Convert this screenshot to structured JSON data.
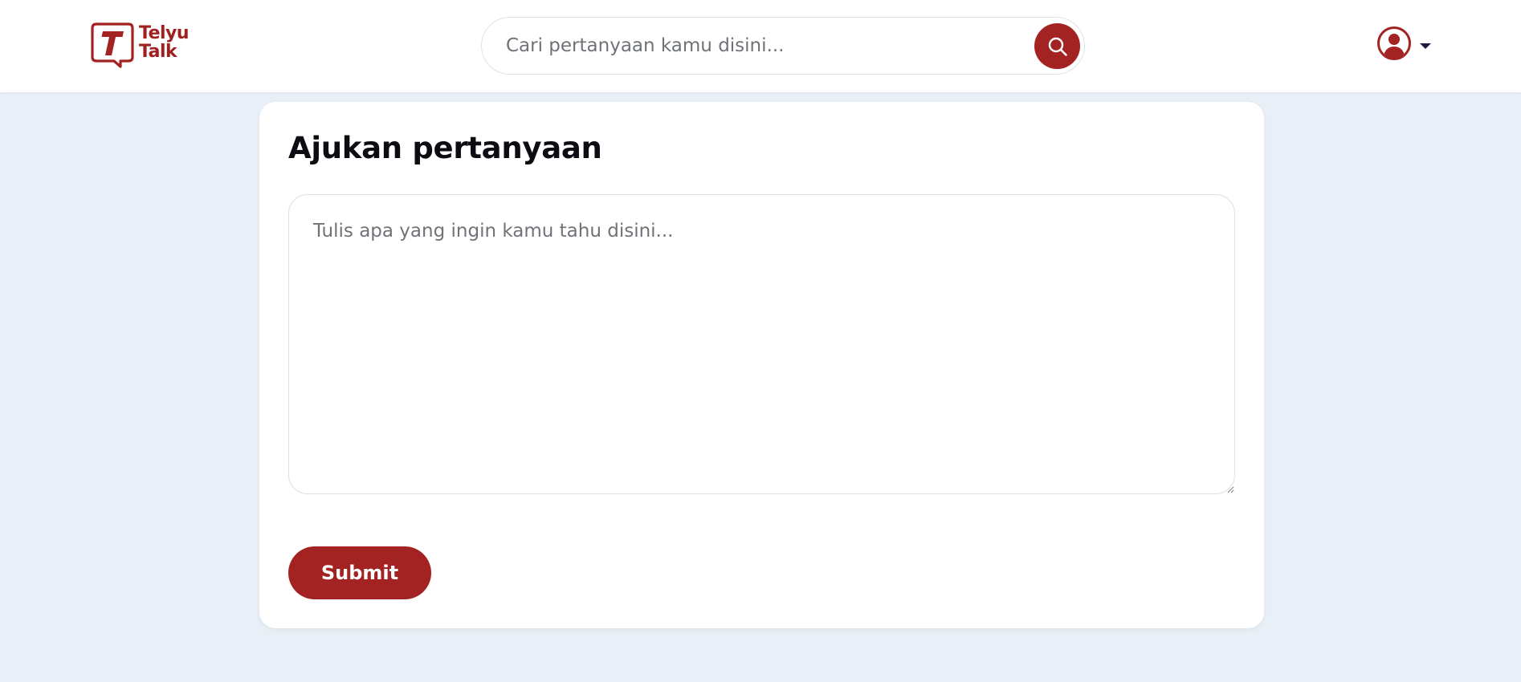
{
  "brand": {
    "line1": "Telyu",
    "line2": "Talk",
    "color": "#a22322"
  },
  "search": {
    "placeholder": "Cari pertanyaan kamu disini...",
    "button_icon": "search-icon"
  },
  "user_menu": {
    "icon": "user-circle-icon",
    "dropdown_icon": "caret-down-icon"
  },
  "ask_form": {
    "title": "Ajukan pertanyaan",
    "placeholder": "Tulis apa yang ingin kamu tahu disini...",
    "submit_label": "Submit"
  },
  "colors": {
    "accent": "#a22322",
    "background": "#e9eff6",
    "card": "#ffffff"
  }
}
